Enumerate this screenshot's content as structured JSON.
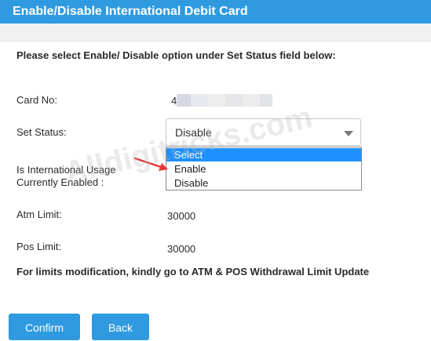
{
  "header": {
    "title": "Enable/Disable International Debit Card"
  },
  "instruction": "Please select Enable/ Disable option under Set Status field below:",
  "form": {
    "card_no_label": "Card No:",
    "card_no_value": "4",
    "set_status_label": "Set Status:",
    "set_status_value": "Disable",
    "status_options": [
      "Select",
      "Enable",
      "Disable"
    ],
    "status_highlighted": "Select",
    "intl_usage_label_line1": "Is International Usage",
    "intl_usage_label_line2": "Currently Enabled :",
    "atm_limit_label": "Atm Limit:",
    "atm_limit_value": "30000",
    "pos_limit_label": "Pos Limit:",
    "pos_limit_value": "30000"
  },
  "note": "For limits modification, kindly go to ATM & POS Withdrawal Limit Update",
  "buttons": {
    "confirm": "Confirm",
    "back": "Back"
  },
  "watermark": "Alldigitricks.com",
  "colors": {
    "accent": "#2f9ae0",
    "highlight": "#1e90ff",
    "arrow": "#e53935"
  }
}
